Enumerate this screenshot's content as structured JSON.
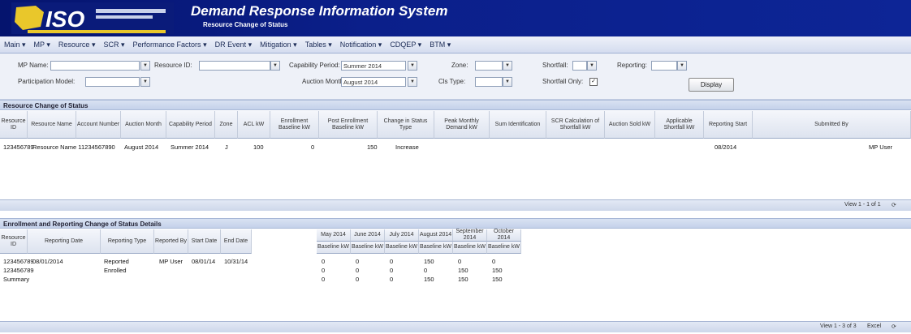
{
  "header": {
    "logo_text": "ISO",
    "title": "Demand Response Information System",
    "subtitle": "Resource Change of Status"
  },
  "menu": [
    "Main",
    "MP",
    "Resource",
    "SCR",
    "Performance Factors",
    "DR Event",
    "Mitigation",
    "Tables",
    "Notification",
    "CDQEP",
    "BTM"
  ],
  "filters": {
    "mp_name_label": "MP Name:",
    "mp_name_value": "",
    "resource_id_label": "Resource ID:",
    "resource_id_value": "",
    "capability_period_label": "Capability Period:",
    "capability_period_value": "Summer 2014",
    "zone_label": "Zone:",
    "zone_value": "",
    "shortfall_label": "Shortfall:",
    "shortfall_value": "",
    "reporting_label": "Reporting:",
    "reporting_value": "",
    "program_label": "Participation Model:",
    "program_value": "",
    "auction_month_label": "Auction Month:",
    "auction_month_value": "August 2014",
    "load_zone_label": "Cls Type:",
    "load_zone_value": "",
    "shortfall_only_label": "Shortfall Only:",
    "display_button": "Display"
  },
  "section1": {
    "title": "Resource Change of Status",
    "columns": [
      "Resource ID",
      "Resource Name",
      "Account Number",
      "Auction Month",
      "Capability Period",
      "Zone",
      "ACL kW",
      "Enrollment Baseline kW",
      "Post Enrollment Baseline kW",
      "Change in Status Type",
      "Peak Monthly Demand kW",
      "Sum Identification",
      "SCR Calculation of Shortfall kW",
      "Auction Sold kW",
      "Applicable Shortfall kW",
      "Reporting Start",
      "Submitted By"
    ],
    "row": {
      "resource_id": "123456789",
      "resource_name": "Resource Name 1",
      "account_number": "1234567890",
      "auction_month": "August 2014",
      "capability_period": "Summer 2014",
      "zone": "J",
      "acl": "100",
      "enrollment": "0",
      "post": "150",
      "change_type": "Increase",
      "reporting_start": "08/2014",
      "submitted_by": "MP User"
    },
    "footer": "View 1 - 1 of 1"
  },
  "section2": {
    "title": "Enrollment and Reporting Change of Status Details",
    "columns": [
      "Resource ID",
      "Reporting Date",
      "Reporting Type",
      "Reported By",
      "Start Date",
      "End Date"
    ],
    "months": [
      "May 2014",
      "June 2014",
      "July 2014",
      "August 2014",
      "September 2014",
      "October 2014"
    ],
    "sublabel": "Baseline kW",
    "rows": [
      {
        "resource_id": "123456789",
        "reporting_date": "08/01/2014",
        "type": "Reported",
        "by": "MP User",
        "start": "08/01/14",
        "end": "10/31/14",
        "v": [
          "0",
          "0",
          "0",
          "150",
          "0",
          "0"
        ]
      },
      {
        "resource_id": "123456789",
        "reporting_date": "",
        "type": "Enrolled",
        "by": "",
        "start": "",
        "end": "",
        "v": [
          "0",
          "0",
          "0",
          "0",
          "150",
          "150"
        ]
      },
      {
        "resource_id": "Summary",
        "reporting_date": "",
        "type": "",
        "by": "",
        "start": "",
        "end": "",
        "v": [
          "0",
          "0",
          "0",
          "150",
          "150",
          "150"
        ]
      }
    ],
    "footer": "View 1 - 3 of 3",
    "export_label": "Excel"
  }
}
